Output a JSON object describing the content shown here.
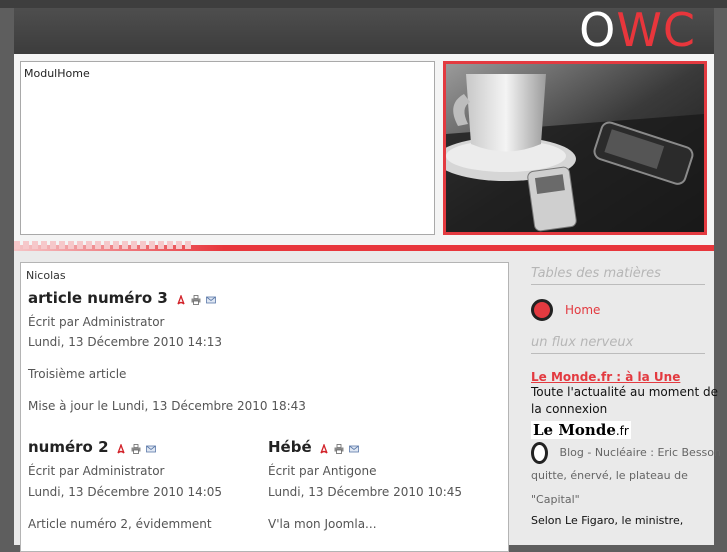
{
  "header": {
    "logo_o": "O",
    "logo_w": "W",
    "logo_c": "C"
  },
  "banner": {
    "module_label": "ModulHome"
  },
  "main": {
    "author_top": "Nicolas",
    "article1": {
      "title": "article numéro 3",
      "written_by": "Écrit par Administrator",
      "date": "Lundi, 13 Décembre 2010 14:13",
      "body": "Troisième article",
      "updated": "Mise à jour le Lundi, 13 Décembre 2010 18:43"
    },
    "article2": {
      "title": "numéro 2",
      "written_by": "Écrit par Administrator",
      "date": "Lundi, 13 Décembre 2010 14:05",
      "body": "Article numéro 2, évidemment"
    },
    "article3": {
      "title": "Hébé",
      "written_by": "Écrit par Antigone",
      "date": "Lundi, 13 Décembre 2010 10:45",
      "body": "V'la mon Joomla..."
    }
  },
  "sidebar": {
    "toc_title": "Tables des matières",
    "menu": [
      {
        "label": "Home"
      }
    ],
    "feed_title": "un flux nerveux",
    "feed_link": "Le Monde.fr : à la Une",
    "feed_desc": "Toute l'actualité au moment de la connexion",
    "lemonde_logo": "Le Monde",
    "lemonde_logo_suffix": ".fr",
    "feed_items": [
      "Blog - Nucléaire : Eric Besson",
      "quitte, énervé, le plateau de",
      "\"Capital\"",
      "Selon Le Figaro, le ministre,"
    ]
  },
  "colors": {
    "accent": "#e33a40",
    "header_bg": "#444444",
    "page_bg": "#5e5e5e"
  },
  "icons": [
    "pdf-icon",
    "print-icon",
    "email-icon"
  ]
}
